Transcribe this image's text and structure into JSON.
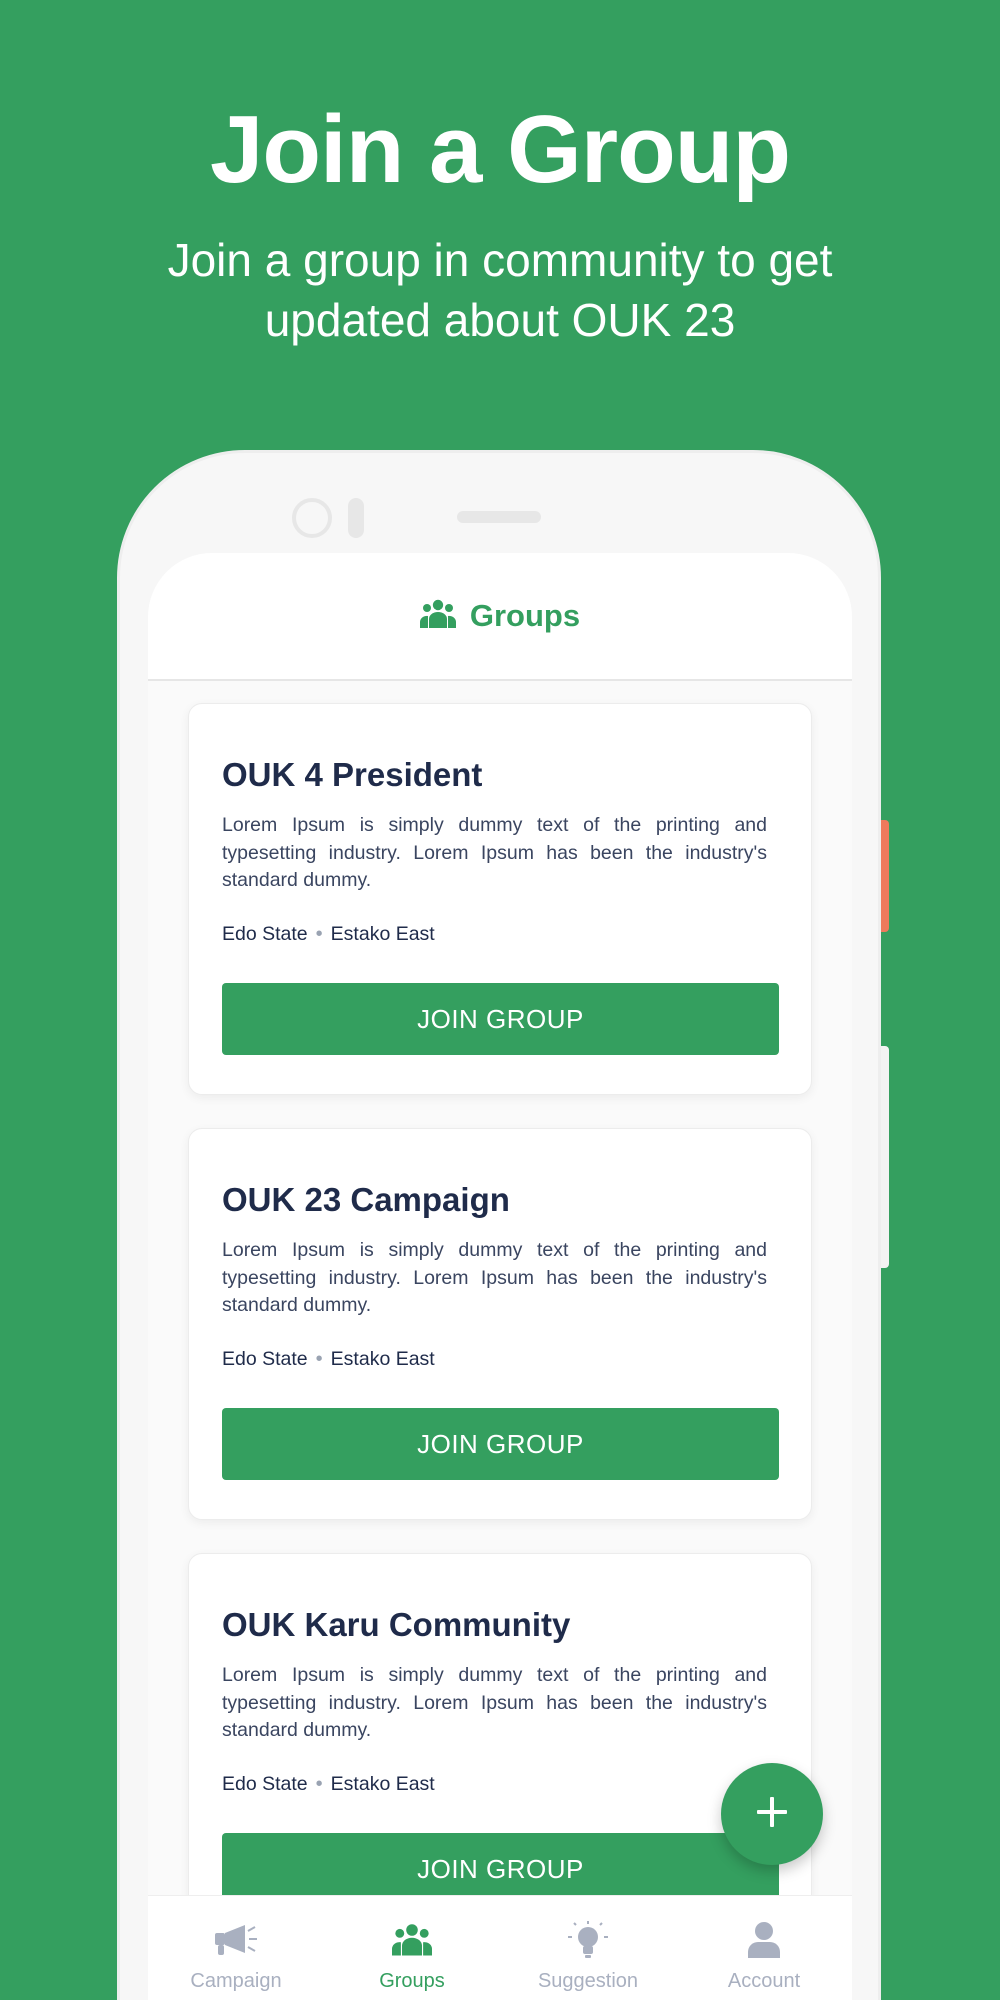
{
  "hero": {
    "title": "Join a Group",
    "subtitle": "Join a group in  community to get updated about OUK 23"
  },
  "header": {
    "title": "Groups",
    "icon": "users-icon"
  },
  "groups": [
    {
      "title": "OUK 4 President",
      "description": "Lorem Ipsum is simply dummy text of the printing and typesetting industry. Lorem Ipsum has been the industry's standard dummy.",
      "state": "Edo State",
      "area": "Estako East",
      "button": "JOIN GROUP"
    },
    {
      "title": "OUK 23 Campaign",
      "description": "Lorem Ipsum is simply dummy text of the printing and typesetting industry. Lorem Ipsum has been the industry's standard dummy.",
      "state": "Edo State",
      "area": "Estako East",
      "button": "JOIN GROUP"
    },
    {
      "title": "OUK Karu Community",
      "description": "Lorem Ipsum is simply dummy text of the printing and typesetting industry. Lorem Ipsum has been the industry's standard dummy.",
      "state": "Edo State",
      "area": "Estako East",
      "button": "JOIN GROUP"
    }
  ],
  "fab": {
    "icon": "plus-icon"
  },
  "nav": [
    {
      "label": "Campaign",
      "icon": "megaphone-icon",
      "active": false
    },
    {
      "label": "Groups",
      "icon": "users-icon",
      "active": true
    },
    {
      "label": "Suggestion",
      "icon": "lightbulb-icon",
      "active": false
    },
    {
      "label": "Account",
      "icon": "user-icon",
      "active": false
    }
  ],
  "colors": {
    "brand_green": "#349f5f",
    "title_navy": "#1f2b4a",
    "nav_inactive": "#a9b0c0",
    "side_button": "#ee7a5c"
  }
}
